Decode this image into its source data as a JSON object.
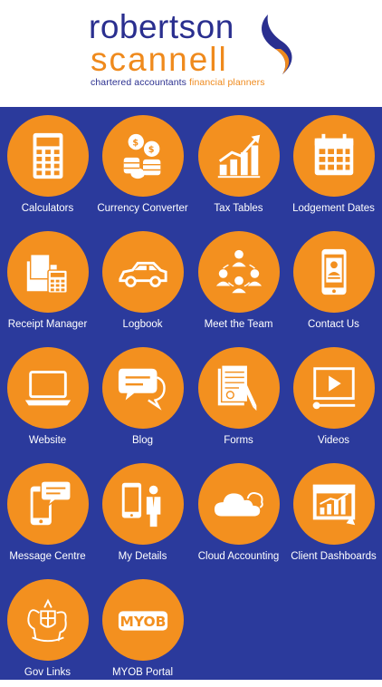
{
  "brand": {
    "name_line1": "robertson",
    "name_line2": "scannell",
    "tagline_a": "chartered accountants",
    "tagline_b": "financial planners"
  },
  "colors": {
    "background": "#2b3a9c",
    "accent": "#f3901f",
    "brand_blue": "#2a2f8f",
    "brand_orange": "#ef8a1d"
  },
  "tiles": [
    {
      "label": "Calculators",
      "icon": "calculator-icon"
    },
    {
      "label": "Currency Converter",
      "icon": "coins-icon"
    },
    {
      "label": "Tax Tables",
      "icon": "bar-chart-icon"
    },
    {
      "label": "Lodgement Dates",
      "icon": "calendar-icon"
    },
    {
      "label": "Receipt Manager",
      "icon": "receipt-folder-icon"
    },
    {
      "label": "Logbook",
      "icon": "car-icon"
    },
    {
      "label": "Meet the Team",
      "icon": "team-icon"
    },
    {
      "label": "Contact Us",
      "icon": "phone-contact-icon"
    },
    {
      "label": "Website",
      "icon": "laptop-icon"
    },
    {
      "label": "Blog",
      "icon": "chat-bubbles-icon"
    },
    {
      "label": "Forms",
      "icon": "document-pen-icon"
    },
    {
      "label": "Videos",
      "icon": "video-player-icon"
    },
    {
      "label": "Message Centre",
      "icon": "phone-message-icon"
    },
    {
      "label": "My Details",
      "icon": "person-phone-icon"
    },
    {
      "label": "Cloud Accounting",
      "icon": "cloud-icon"
    },
    {
      "label": "Client Dashboards",
      "icon": "dashboard-icon"
    },
    {
      "label": "Gov Links",
      "icon": "coat-of-arms-icon"
    },
    {
      "label": "MYOB Portal",
      "icon": "myob-logo-icon"
    }
  ],
  "myob_text": "MYOB"
}
